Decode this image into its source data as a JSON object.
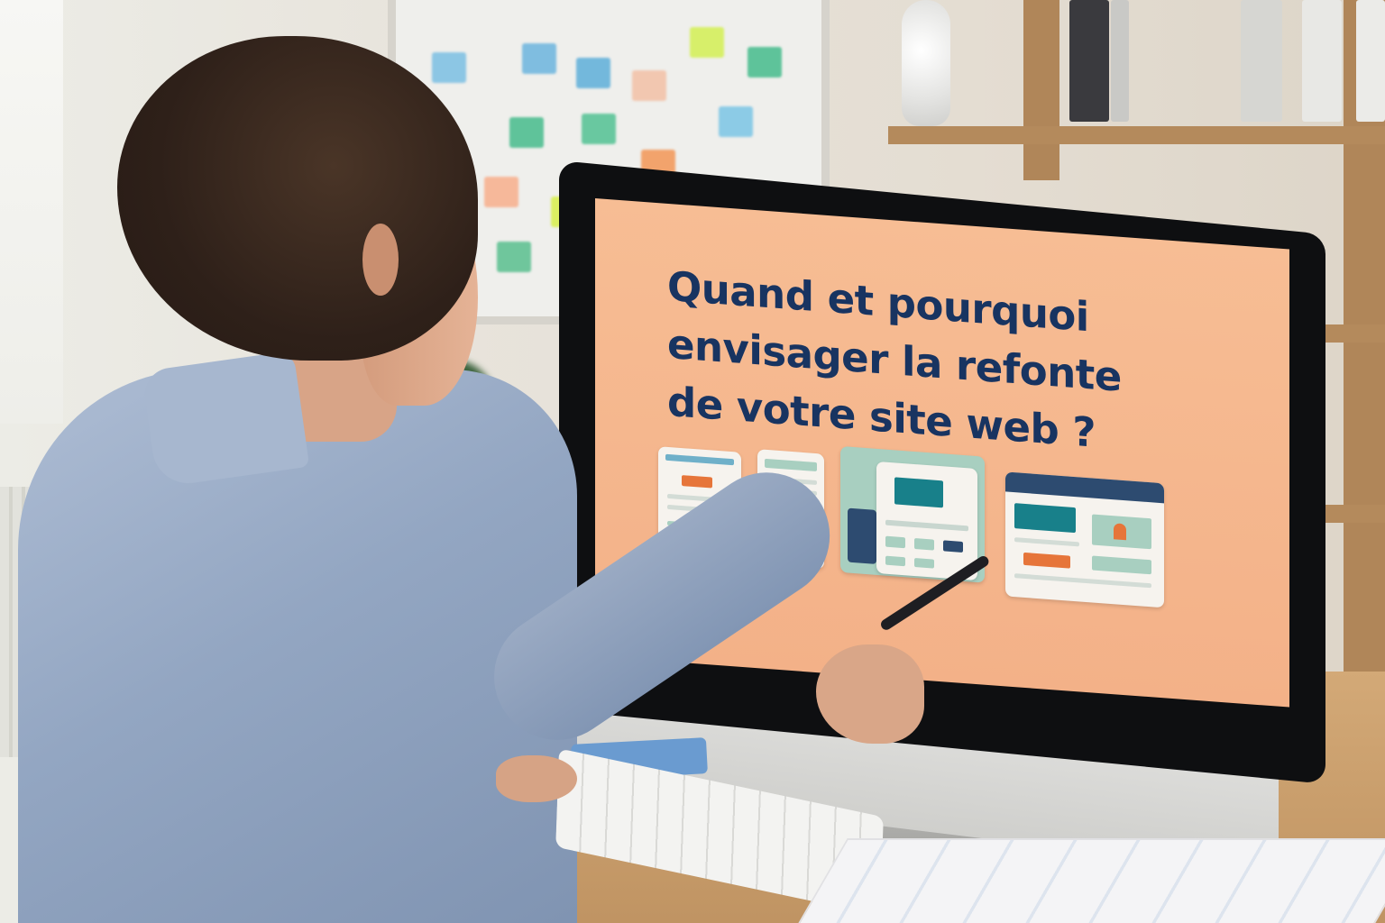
{
  "screen": {
    "headline_lines": [
      "Quand et pourquoi",
      "envisager la refonte",
      "de votre site web ?"
    ],
    "headline_color": "#183461",
    "background_color": "#f5b68c"
  },
  "scene": {
    "accent_colors": {
      "teal": "#18808a",
      "orange": "#e6753a",
      "navy": "#2d4b70",
      "mint": "#a8cfc0"
    }
  }
}
